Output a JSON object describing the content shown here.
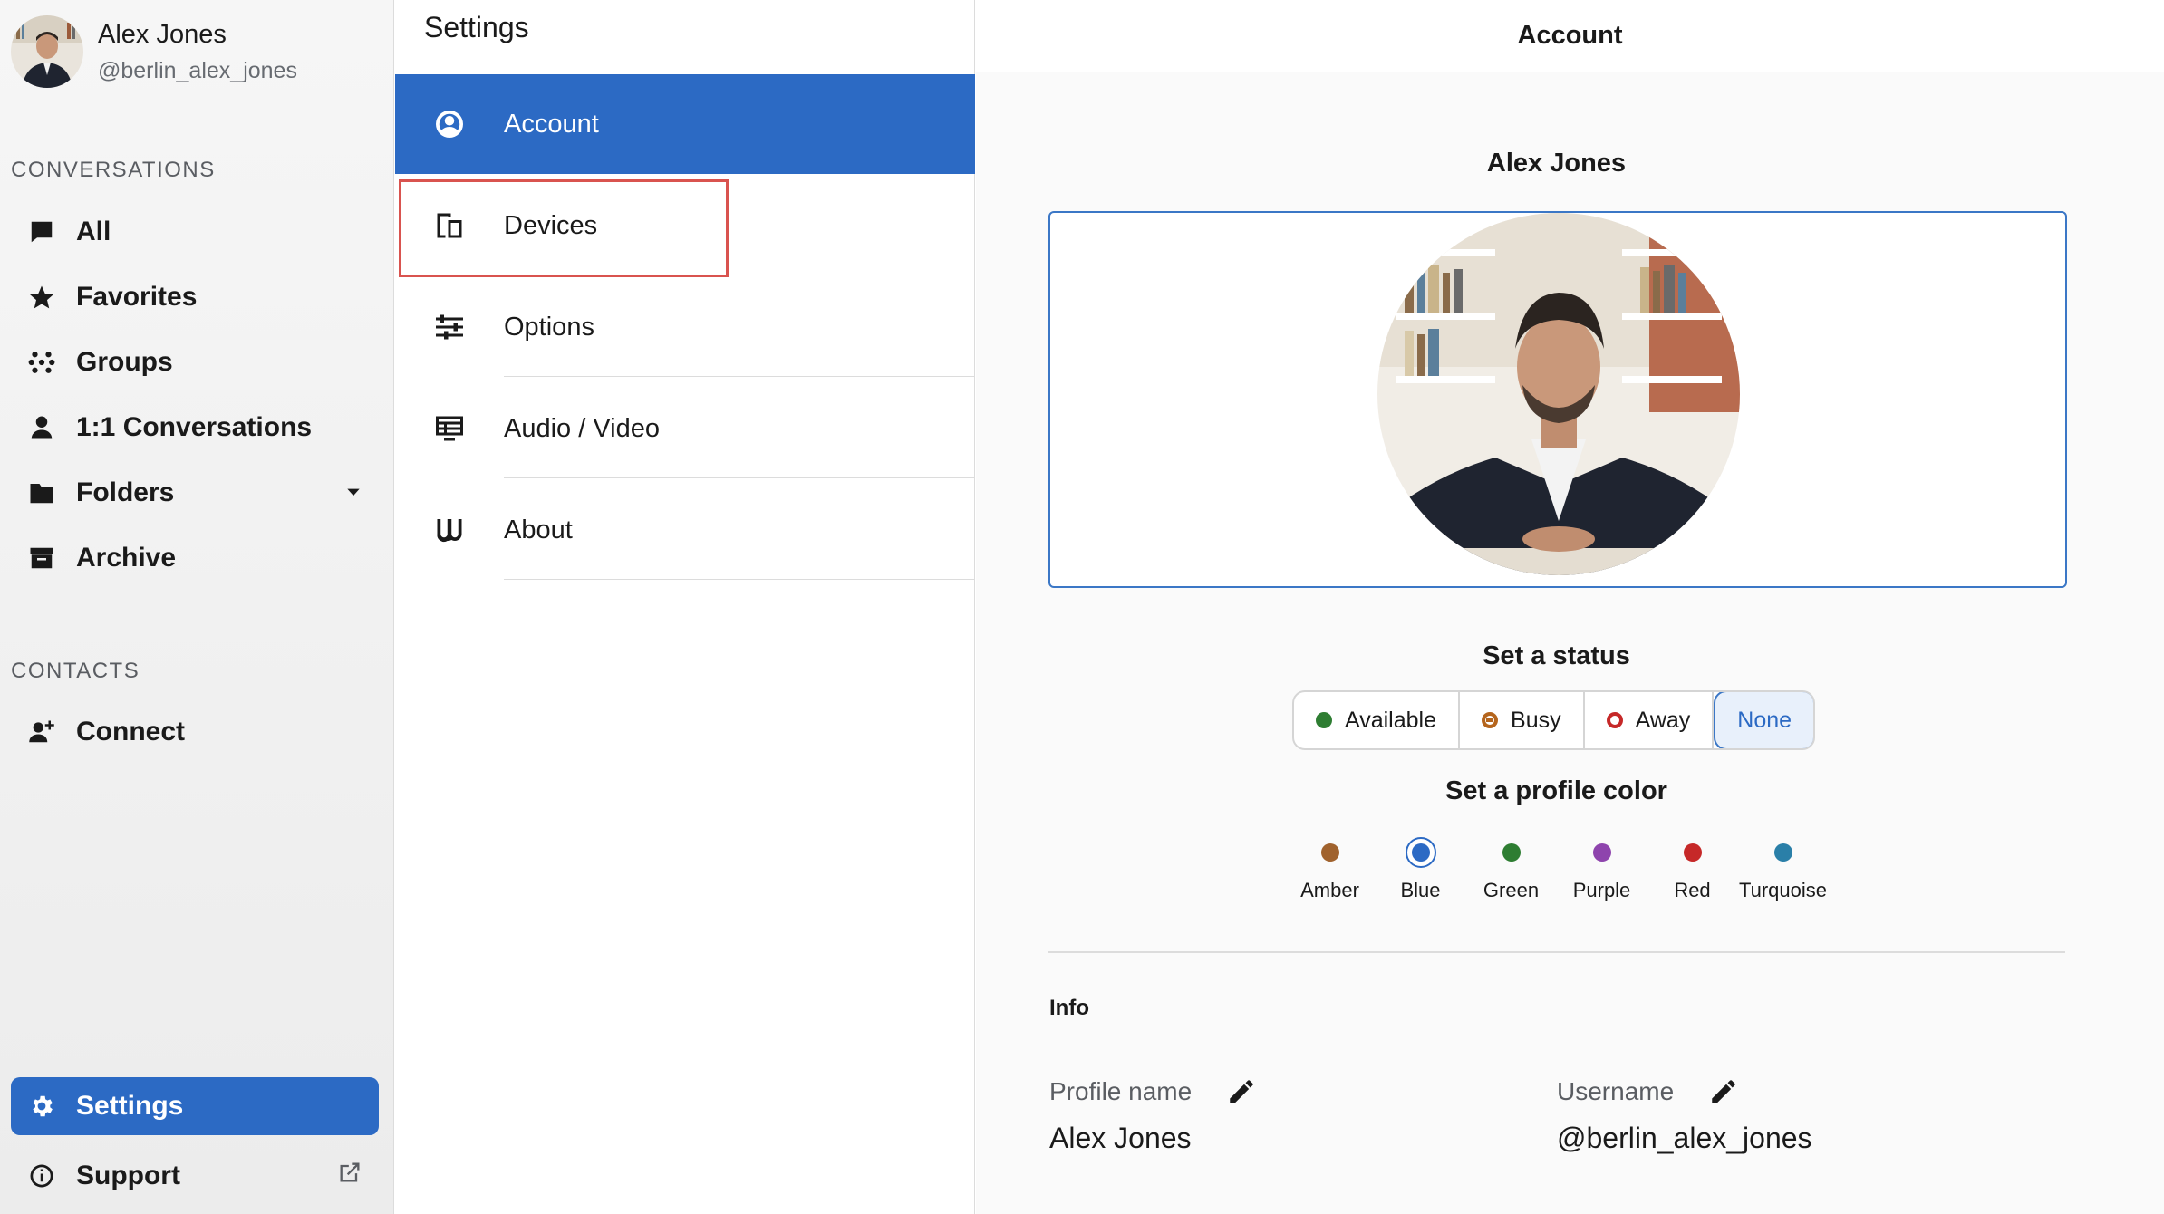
{
  "user": {
    "name": "Alex Jones",
    "handle": "@berlin_alex_jones"
  },
  "sidebar": {
    "conversations_title": "CONVERSATIONS",
    "items": [
      {
        "label": "All",
        "icon": "chat-bubble-icon"
      },
      {
        "label": "Favorites",
        "icon": "star-icon"
      },
      {
        "label": "Groups",
        "icon": "groups-dots-icon"
      },
      {
        "label": "1:1 Conversations",
        "icon": "person-icon"
      },
      {
        "label": "Folders",
        "icon": "folder-icon"
      },
      {
        "label": "Archive",
        "icon": "archive-icon"
      }
    ],
    "contacts_title": "CONTACTS",
    "connect_label": "Connect",
    "settings_label": "Settings",
    "support_label": "Support"
  },
  "settings": {
    "title": "Settings",
    "items": [
      {
        "label": "Account",
        "icon": "account-circle-icon"
      },
      {
        "label": "Devices",
        "icon": "devices-icon"
      },
      {
        "label": "Options",
        "icon": "sliders-icon"
      },
      {
        "label": "Audio / Video",
        "icon": "audio-video-icon"
      },
      {
        "label": "About",
        "icon": "wire-logo-icon"
      }
    ]
  },
  "account": {
    "header": "Account",
    "name": "Alex Jones",
    "status_title": "Set a status",
    "statuses": [
      {
        "label": "Available",
        "color": "#2e7d32"
      },
      {
        "label": "Busy",
        "color": "#b5651d"
      },
      {
        "label": "Away",
        "color": "#c62828"
      },
      {
        "label": "None",
        "color": ""
      }
    ],
    "selected_status": "None",
    "color_title": "Set a profile color",
    "colors": [
      {
        "label": "Amber",
        "hex": "#a0622d"
      },
      {
        "label": "Blue",
        "hex": "#2c6ac4"
      },
      {
        "label": "Green",
        "hex": "#2e7d32"
      },
      {
        "label": "Purple",
        "hex": "#8e44ad"
      },
      {
        "label": "Red",
        "hex": "#c62828"
      },
      {
        "label": "Turquoise",
        "hex": "#2a7fa8"
      }
    ],
    "selected_color": "Blue",
    "info_title": "Info",
    "profile_name_label": "Profile name",
    "profile_name_value": "Alex Jones",
    "username_label": "Username",
    "username_value": "@berlin_alex_jones"
  },
  "accent_color": "#2c6ac4"
}
